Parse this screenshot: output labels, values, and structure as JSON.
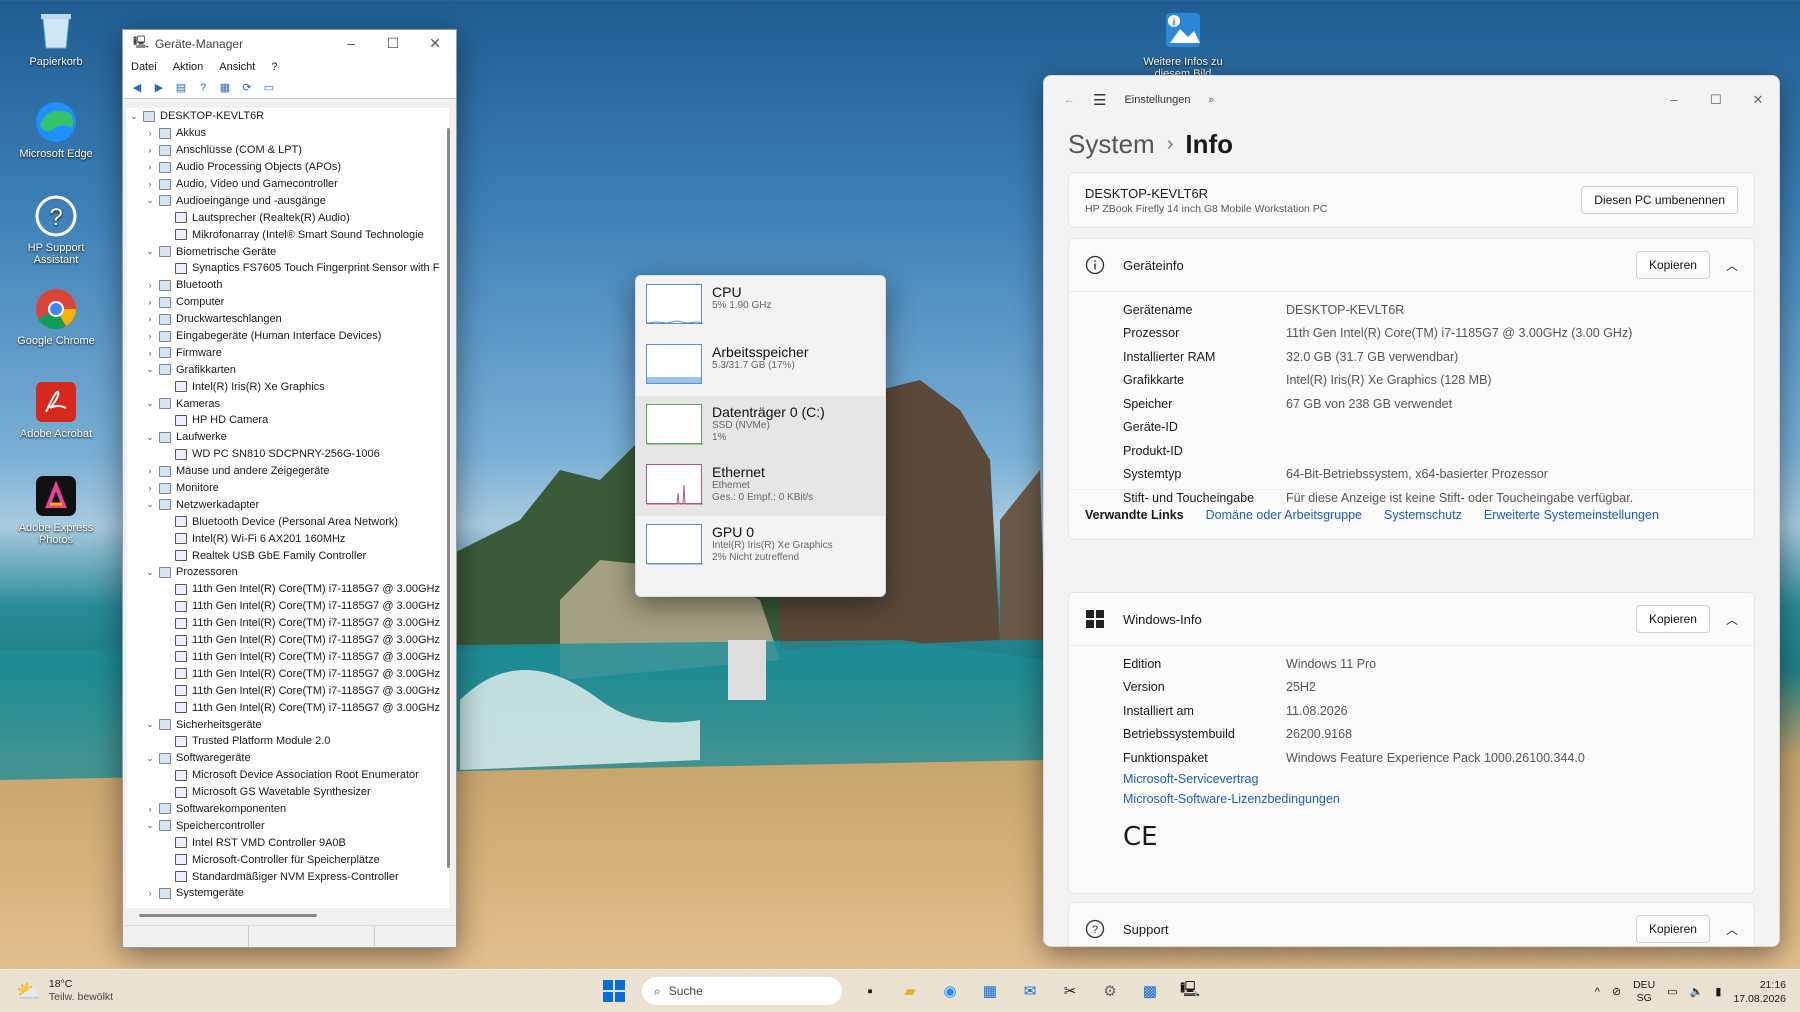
{
  "desktop": {
    "icons": [
      {
        "label": "Papierkorb",
        "icon": "recycle-bin-icon"
      },
      {
        "label": "Microsoft Edge",
        "icon": "edge-icon"
      },
      {
        "label": "HP Support Assistant",
        "icon": "hp-support-icon"
      },
      {
        "label": "Google Chrome",
        "icon": "chrome-icon"
      },
      {
        "label": "Adobe Acrobat",
        "icon": "acrobat-icon"
      },
      {
        "label": "Adobe Express Photos",
        "icon": "adobe-express-icon"
      }
    ],
    "top_icon": {
      "label": "Weitere Infos zu diesem Bild",
      "icon": "spotlight-info-icon"
    }
  },
  "device_manager": {
    "title": "Geräte-Manager",
    "menu": [
      "Datei",
      "Aktion",
      "Ansicht",
      "?"
    ],
    "tree": [
      {
        "label": "DESKTOP-KEVLT6R",
        "level": 0,
        "exp": "v"
      },
      {
        "label": "Akkus",
        "level": 1,
        "exp": ">"
      },
      {
        "label": "Anschlüsse (COM & LPT)",
        "level": 1,
        "exp": ">"
      },
      {
        "label": "Audio Processing Objects (APOs)",
        "level": 1,
        "exp": ">"
      },
      {
        "label": "Audio, Video und Gamecontroller",
        "level": 1,
        "exp": ">"
      },
      {
        "label": "Audioeingänge und -ausgänge",
        "level": 1,
        "exp": "v"
      },
      {
        "label": "Lautsprecher (Realtek(R) Audio)",
        "level": 2,
        "exp": ""
      },
      {
        "label": "Mikrofonarray (Intel® Smart Sound Technologie",
        "level": 2,
        "exp": ""
      },
      {
        "label": "Biometrische Geräte",
        "level": 1,
        "exp": "v"
      },
      {
        "label": "Synaptics FS7605 Touch Fingerprint Sensor with F",
        "level": 2,
        "exp": ""
      },
      {
        "label": "Bluetooth",
        "level": 1,
        "exp": ">"
      },
      {
        "label": "Computer",
        "level": 1,
        "exp": ">"
      },
      {
        "label": "Druckwarteschlangen",
        "level": 1,
        "exp": ">"
      },
      {
        "label": "Eingabegeräte (Human Interface Devices)",
        "level": 1,
        "exp": ">"
      },
      {
        "label": "Firmware",
        "level": 1,
        "exp": ">"
      },
      {
        "label": "Grafikkarten",
        "level": 1,
        "exp": "v"
      },
      {
        "label": "Intel(R) Iris(R) Xe Graphics",
        "level": 2,
        "exp": ""
      },
      {
        "label": "Kameras",
        "level": 1,
        "exp": "v"
      },
      {
        "label": "HP HD Camera",
        "level": 2,
        "exp": ""
      },
      {
        "label": "Laufwerke",
        "level": 1,
        "exp": "v"
      },
      {
        "label": "WD PC SN810 SDCPNRY-256G-1006",
        "level": 2,
        "exp": ""
      },
      {
        "label": "Mäuse und andere Zeigegeräte",
        "level": 1,
        "exp": ">"
      },
      {
        "label": "Monitore",
        "level": 1,
        "exp": ">"
      },
      {
        "label": "Netzwerkadapter",
        "level": 1,
        "exp": "v"
      },
      {
        "label": "Bluetooth Device (Personal Area Network)",
        "level": 2,
        "exp": ""
      },
      {
        "label": "Intel(R) Wi-Fi 6 AX201 160MHz",
        "level": 2,
        "exp": ""
      },
      {
        "label": "Realtek USB GbE Family Controller",
        "level": 2,
        "exp": ""
      },
      {
        "label": "Prozessoren",
        "level": 1,
        "exp": "v"
      },
      {
        "label": "11th Gen Intel(R) Core(TM) i7-1185G7 @ 3.00GHz",
        "level": 2,
        "exp": ""
      },
      {
        "label": "11th Gen Intel(R) Core(TM) i7-1185G7 @ 3.00GHz",
        "level": 2,
        "exp": ""
      },
      {
        "label": "11th Gen Intel(R) Core(TM) i7-1185G7 @ 3.00GHz",
        "level": 2,
        "exp": ""
      },
      {
        "label": "11th Gen Intel(R) Core(TM) i7-1185G7 @ 3.00GHz",
        "level": 2,
        "exp": ""
      },
      {
        "label": "11th Gen Intel(R) Core(TM) i7-1185G7 @ 3.00GHz",
        "level": 2,
        "exp": ""
      },
      {
        "label": "11th Gen Intel(R) Core(TM) i7-1185G7 @ 3.00GHz",
        "level": 2,
        "exp": ""
      },
      {
        "label": "11th Gen Intel(R) Core(TM) i7-1185G7 @ 3.00GHz",
        "level": 2,
        "exp": ""
      },
      {
        "label": "11th Gen Intel(R) Core(TM) i7-1185G7 @ 3.00GHz",
        "level": 2,
        "exp": ""
      },
      {
        "label": "Sicherheitsgeräte",
        "level": 1,
        "exp": "v"
      },
      {
        "label": "Trusted Platform Module 2.0",
        "level": 2,
        "exp": ""
      },
      {
        "label": "Softwaregeräte",
        "level": 1,
        "exp": "v"
      },
      {
        "label": "Microsoft Device Association Root Enumerator",
        "level": 2,
        "exp": ""
      },
      {
        "label": "Microsoft GS Wavetable Synthesizer",
        "level": 2,
        "exp": ""
      },
      {
        "label": "Softwarekomponenten",
        "level": 1,
        "exp": ">"
      },
      {
        "label": "Speichercontroller",
        "level": 1,
        "exp": "v"
      },
      {
        "label": "Intel RST VMD Controller 9A0B",
        "level": 2,
        "exp": ""
      },
      {
        "label": "Microsoft-Controller für Speicherplätze",
        "level": 2,
        "exp": ""
      },
      {
        "label": "Standardmäßiger NVM Express-Controller",
        "level": 2,
        "exp": ""
      },
      {
        "label": "Systemgeräte",
        "level": 1,
        "exp": ">"
      }
    ]
  },
  "perf": {
    "items": [
      {
        "name": "CPU",
        "sub1": "5% 1.90 GHz",
        "sub2": ""
      },
      {
        "name": "Arbeitsspeicher",
        "sub1": "5.3/31.7 GB (17%)",
        "sub2": ""
      },
      {
        "name": "Datenträger 0 (C:)",
        "sub1": "SSD (NVMe)",
        "sub2": "1%"
      },
      {
        "name": "Ethernet",
        "sub1": "Ethernet",
        "sub2": "Ges.: 0 Empf.: 0 KBit/s"
      },
      {
        "name": "GPU 0",
        "sub1": "Intel(R) Iris(R) Xe Graphics",
        "sub2": "2% Nicht zutreffend"
      }
    ],
    "memory_fill": 0.17
  },
  "settings": {
    "app_title": "Einstellungen",
    "crumb_system": "System",
    "crumb_sep": "›",
    "crumb_page": "Info",
    "pc_name": "DESKTOP-KEVLT6R",
    "pc_model": "HP ZBook Firefly 14 inch G8 Mobile Workstation PC",
    "rename_btn": "Diesen PC umbenennen",
    "device_title": "Geräteinfo",
    "copy_btn": "Kopieren",
    "device_rows": [
      {
        "k": "Gerätename",
        "v": "DESKTOP-KEVLT6R"
      },
      {
        "k": "Prozessor",
        "v": "11th Gen Intel(R) Core(TM) i7-1185G7 @ 3.00GHz (3.00 GHz)"
      },
      {
        "k": "Installierter RAM",
        "v": "32.0 GB (31.7 GB verwendbar)"
      },
      {
        "k": "Grafikkarte",
        "v": "Intel(R) Iris(R) Xe Graphics (128 MB)"
      },
      {
        "k": "Speicher",
        "v": "67 GB von 238 GB verwendet"
      },
      {
        "k": "Geräte-ID",
        "v": ""
      },
      {
        "k": "Produkt-ID",
        "v": ""
      },
      {
        "k": "Systemtyp",
        "v": "64-Bit-Betriebssystem, x64-basierter Prozessor"
      },
      {
        "k": "Stift- und Toucheingabe",
        "v": "Für diese Anzeige ist keine Stift- oder Toucheingabe verfügbar."
      }
    ],
    "related_label": "Verwandte Links",
    "related_links": [
      "Domäne oder Arbeitsgruppe",
      "Systemschutz",
      "Erweiterte Systemeinstellungen"
    ],
    "windows_title": "Windows-Info",
    "windows_rows": [
      {
        "k": "Edition",
        "v": "Windows 11 Pro"
      },
      {
        "k": "Version",
        "v": "25H2"
      },
      {
        "k": "Installiert am",
        "v": "11.08.2026"
      },
      {
        "k": "Betriebssystembuild",
        "v": "26200.9168"
      },
      {
        "k": "Funktionspaket",
        "v": "Windows Feature Experience Pack 1000.26100.344.0"
      }
    ],
    "windows_links": [
      "Microsoft-Servicevertrag",
      "Microsoft-Software-Lizenzbedingungen"
    ],
    "ce_mark": "CE",
    "support_title": "Support"
  },
  "taskbar": {
    "weather_temp": "18°C",
    "weather_desc": "Teilw. bewölkt",
    "search_placeholder": "Suche",
    "lang1": "DEU",
    "lang2": "SG",
    "time": "21:16",
    "date": "17.08.2026"
  },
  "colors": {
    "accent": "#1d5fb8",
    "start_blue": "#0a6cd6"
  }
}
